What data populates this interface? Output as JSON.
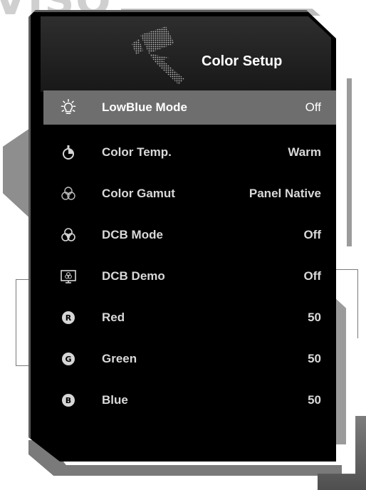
{
  "logo_fragment": "VISO",
  "header": {
    "title": "Color Setup",
    "icon": "paint-roller-icon"
  },
  "menu": {
    "items": [
      {
        "label": "LowBlue Mode",
        "value": "Off",
        "icon": "bulb-icon",
        "selected": true
      },
      {
        "label": "Color Temp.",
        "value": "Warm",
        "icon": "thermometer-icon",
        "selected": false
      },
      {
        "label": "Color Gamut",
        "value": "Panel Native",
        "icon": "rgb-circles-icon",
        "selected": false
      },
      {
        "label": "DCB Mode",
        "value": "Off",
        "icon": "dcb-mode-icon",
        "selected": false
      },
      {
        "label": "DCB Demo",
        "value": "Off",
        "icon": "dcb-demo-icon",
        "selected": false
      },
      {
        "label": "Red",
        "value": "50",
        "icon": "red-channel-icon",
        "letter": "R",
        "selected": false
      },
      {
        "label": "Green",
        "value": "50",
        "icon": "green-channel-icon",
        "letter": "G",
        "selected": false
      },
      {
        "label": "Blue",
        "value": "50",
        "icon": "blue-channel-icon",
        "letter": "B",
        "selected": false
      }
    ]
  },
  "colors": {
    "panel_bg": "#000000",
    "selected_row": "#6e6e6e",
    "text": "#d9d9d9",
    "frame": "#5c5c5c"
  }
}
